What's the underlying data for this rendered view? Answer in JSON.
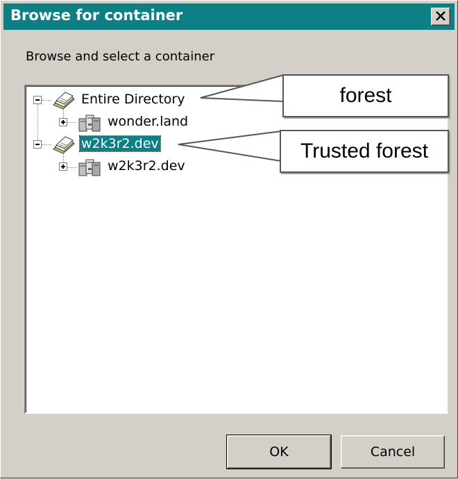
{
  "window": {
    "title": "Browse for container",
    "close_glyph": "✕",
    "instruction": "Browse and select a container"
  },
  "tree": {
    "items": [
      {
        "label": "Entire Directory",
        "icon": "directory-book-icon",
        "expander": "minus",
        "selected": false
      },
      {
        "label": "wonder.land",
        "icon": "domain-servers-icon",
        "expander": "plus",
        "selected": false
      },
      {
        "label": "w2k3r2.dev",
        "icon": "directory-book-icon",
        "expander": "minus",
        "selected": true
      },
      {
        "label": "w2k3r2.dev",
        "icon": "domain-servers-icon",
        "expander": "plus",
        "selected": false
      }
    ]
  },
  "annotations": {
    "forest": "forest",
    "trusted_forest": "Trusted forest"
  },
  "buttons": {
    "ok": "OK",
    "cancel": "Cancel"
  },
  "colors": {
    "titlebar": "#0d8086",
    "selection": "#0d8086",
    "dialog_face": "#d4d0c8"
  }
}
